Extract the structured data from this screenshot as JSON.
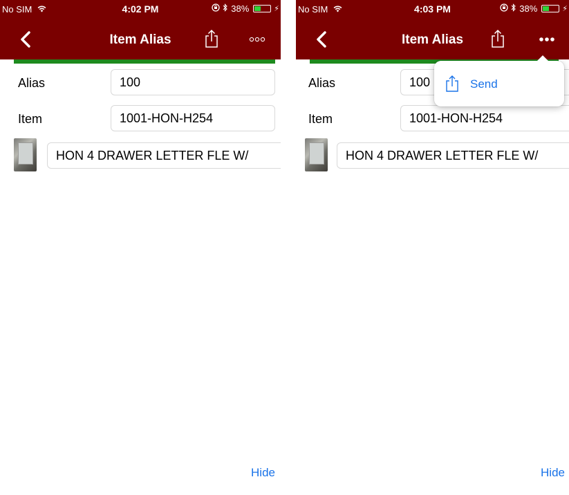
{
  "screens": [
    {
      "status": {
        "carrier": "No SIM",
        "time": "4:02 PM",
        "battery": "38%",
        "battery_level": 0.38
      },
      "nav": {
        "title": "Item Alias"
      },
      "form": {
        "alias_label": "Alias",
        "alias_value": "100",
        "item_label": "Item",
        "item_value": "1001-HON-H254",
        "description": "HON 4 DRAWER LETTER FLE W/"
      },
      "footer": {
        "hide_label": "Hide"
      }
    },
    {
      "status": {
        "carrier": "No SIM",
        "time": "4:03 PM",
        "battery": "38%",
        "battery_level": 0.38
      },
      "nav": {
        "title": "Item Alias"
      },
      "form": {
        "alias_label": "Alias",
        "alias_value": "100",
        "item_label": "Item",
        "item_value": "1001-HON-H254",
        "description": "HON 4 DRAWER LETTER FLE W/"
      },
      "popover": {
        "send_label": "Send"
      },
      "footer": {
        "hide_label": "Hide"
      }
    }
  ],
  "colors": {
    "header": "#7a0000",
    "accent_green": "#1e8a1e",
    "link_blue": "#1a73e8"
  },
  "icons": [
    "wifi-icon",
    "rotation-lock-icon",
    "bluetooth-icon",
    "battery-icon",
    "back-chevron-icon",
    "share-icon",
    "more-icon"
  ]
}
